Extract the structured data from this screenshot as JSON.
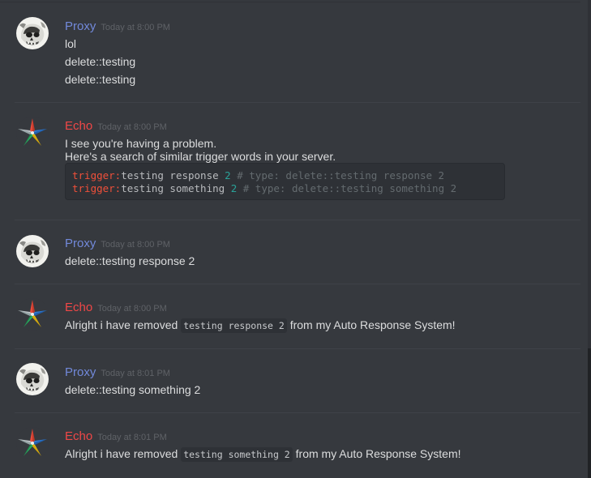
{
  "users": {
    "proxy": {
      "name": "Proxy",
      "color": "#7289da",
      "avatar_icon": "skull-icon"
    },
    "echo": {
      "name": "Echo",
      "color": "#f04747",
      "avatar_icon": "multicolor-star-icon"
    }
  },
  "messages": [
    {
      "author": "Proxy",
      "timestamp": "Today at 8:00 PM",
      "lines": [
        "lol",
        "delete::testing",
        "delete::testing"
      ]
    },
    {
      "author": "Echo",
      "timestamp": "Today at 8:00 PM",
      "lines": [
        "I see you're having a problem.",
        "Here's a search of similar trigger words in your server."
      ],
      "code": [
        {
          "kw": "trigger:",
          "text": "testing response ",
          "num": "2",
          "comment": " # type: delete::testing response 2"
        },
        {
          "kw": "trigger:",
          "text": "testing something ",
          "num": "2",
          "comment": " # type: delete::testing something 2"
        }
      ]
    },
    {
      "author": "Proxy",
      "timestamp": "Today at 8:00 PM",
      "lines": [
        "delete::testing response 2"
      ]
    },
    {
      "author": "Echo",
      "timestamp": "Today at 8:00 PM",
      "pre": "Alright i have removed ",
      "code_inline": "testing response 2",
      "post": " from my Auto Response System!"
    },
    {
      "author": "Proxy",
      "timestamp": "Today at 8:01 PM",
      "lines": [
        "delete::testing something 2"
      ]
    },
    {
      "author": "Echo",
      "timestamp": "Today at 8:01 PM",
      "pre": "Alright i have removed ",
      "code_inline": "testing something 2",
      "post": " from my Auto Response System!"
    }
  ]
}
